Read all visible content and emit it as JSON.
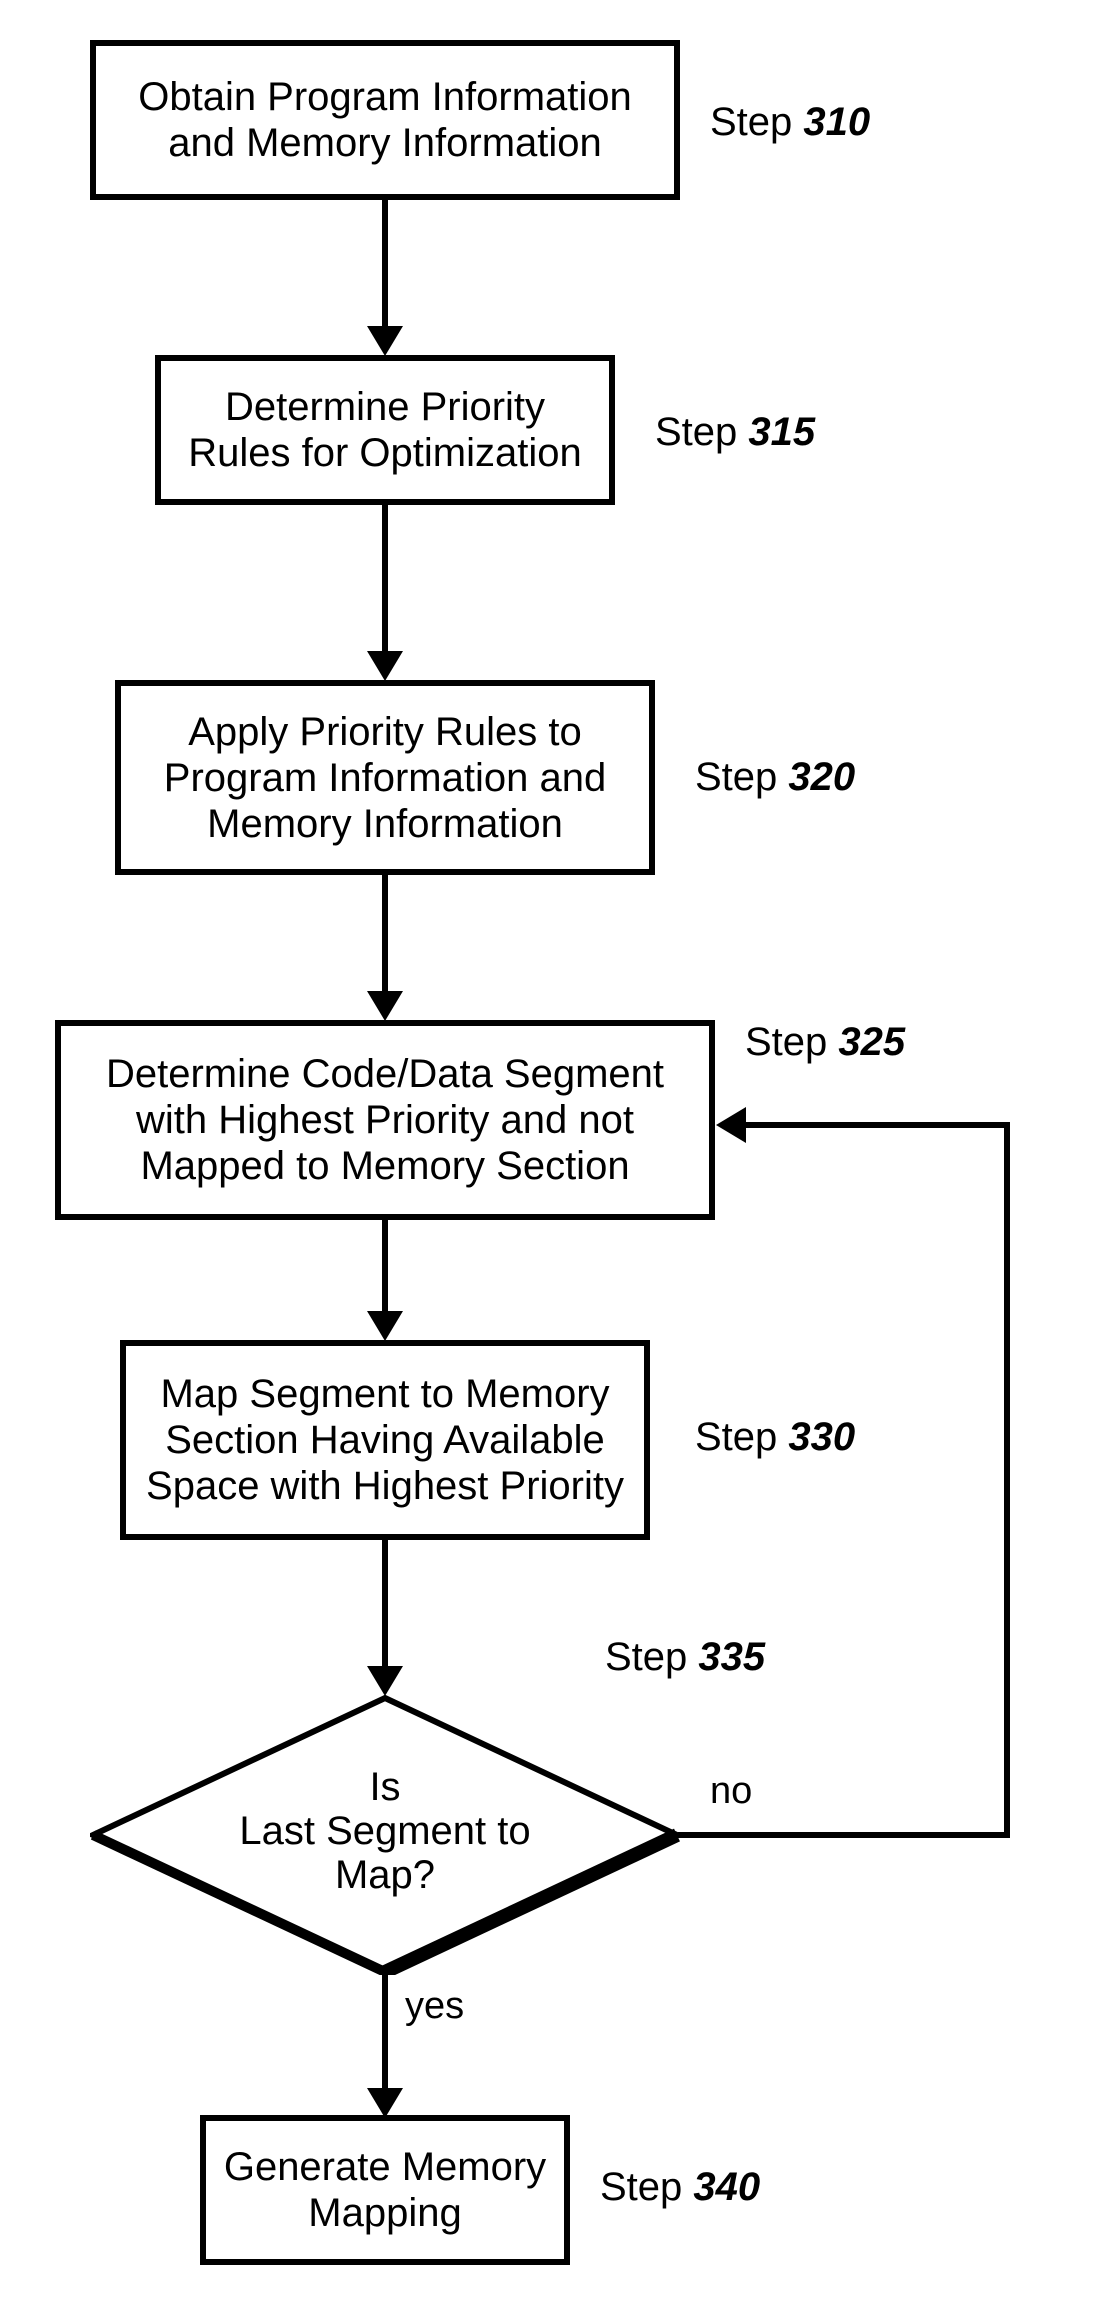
{
  "chart_data": {
    "type": "flowchart",
    "nodes": [
      {
        "id": "310",
        "shape": "rect",
        "text": "Obtain Program Information and Memory Information",
        "label_prefix": "Step",
        "label_num": "310"
      },
      {
        "id": "315",
        "shape": "rect",
        "text": "Determine Priority Rules for Optimization",
        "label_prefix": "Step",
        "label_num": "315"
      },
      {
        "id": "320",
        "shape": "rect",
        "text": "Apply Priority Rules to Program Information and Memory Information",
        "label_prefix": "Step",
        "label_num": "320"
      },
      {
        "id": "325",
        "shape": "rect",
        "text": "Determine Code/Data Segment with Highest Priority and not Mapped to Memory Section",
        "label_prefix": "Step",
        "label_num": "325"
      },
      {
        "id": "330",
        "shape": "rect",
        "text": "Map Segment to Memory Section Having Available Space with Highest Priority",
        "label_prefix": "Step",
        "label_num": "330"
      },
      {
        "id": "335",
        "shape": "diamond",
        "text": "Is Last Segment to Map?",
        "label_prefix": "Step",
        "label_num": "335"
      },
      {
        "id": "340",
        "shape": "rect",
        "text": "Generate Memory Mapping",
        "label_prefix": "Step",
        "label_num": "340"
      }
    ],
    "edges": [
      {
        "from": "310",
        "to": "315",
        "label": ""
      },
      {
        "from": "315",
        "to": "320",
        "label": ""
      },
      {
        "from": "320",
        "to": "325",
        "label": ""
      },
      {
        "from": "325",
        "to": "330",
        "label": ""
      },
      {
        "from": "330",
        "to": "335",
        "label": ""
      },
      {
        "from": "335",
        "to": "325",
        "label": "no"
      },
      {
        "from": "335",
        "to": "340",
        "label": "yes"
      }
    ]
  }
}
